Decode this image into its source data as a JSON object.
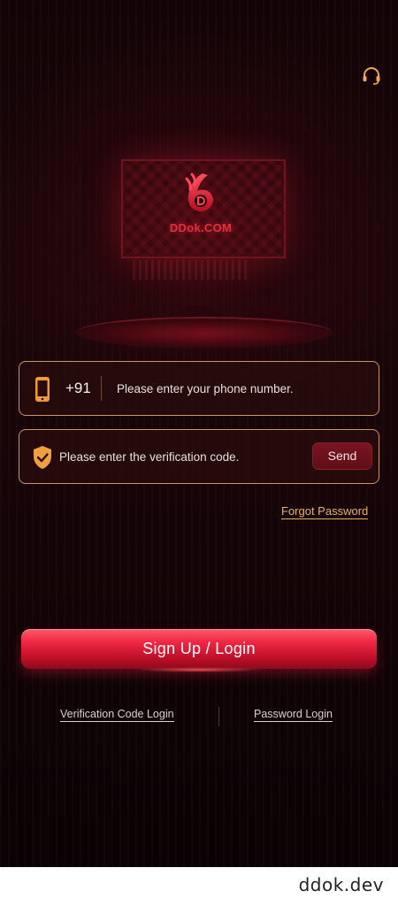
{
  "header": {
    "support_icon": "headset-icon"
  },
  "brand": {
    "logo_text": "DDok.COM",
    "logo_icon": "ddok-logo-icon",
    "accent": "#e0303a"
  },
  "phone_field": {
    "icon": "phone-icon",
    "country_code": "+91",
    "placeholder": "Please enter your phone number.",
    "value": ""
  },
  "code_field": {
    "icon": "shield-check-icon",
    "placeholder": "Please enter the verification code.",
    "value": "",
    "send_label": "Send"
  },
  "forgot_password_label": "Forgot Password",
  "login_button_label": "Sign Up / Login",
  "alt_login": {
    "verification_code_label": "Verification Code Login",
    "password_label": "Password Login"
  },
  "footer": {
    "domain": "ddok.dev"
  },
  "colors": {
    "field_border": "#c9956b",
    "link_gold": "#e8b16a",
    "button_red": "#f12a45",
    "background": "#1b0609"
  }
}
